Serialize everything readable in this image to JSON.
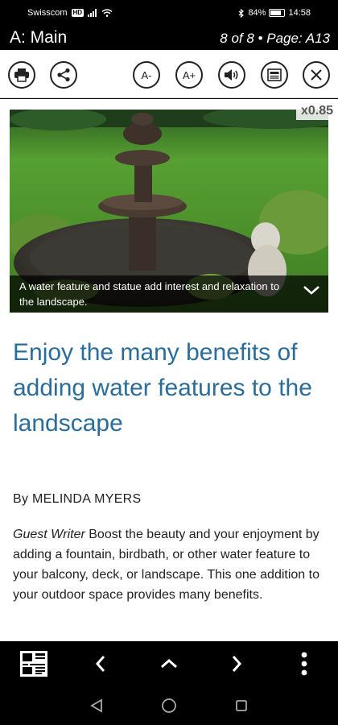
{
  "status_bar": {
    "carrier": "Swisscom",
    "network_badge": "HD",
    "battery_text": "84%",
    "battery_level": 0.84,
    "time": "14:58"
  },
  "title_bar": {
    "section": "A: Main",
    "page_info": "8 of 8 • Page: A13"
  },
  "toolbar": {
    "font_decrease_label": "A-",
    "font_increase_label": "A+",
    "icons": [
      "print-icon",
      "share-icon",
      "font-decrease-icon",
      "font-increase-icon",
      "speaker-icon",
      "article-view-icon",
      "close-icon"
    ]
  },
  "article": {
    "zoom": "x0.85",
    "image_caption": "A water feature and statue add interest and relaxation to the landscape.",
    "headline": "Enjoy the many benefits of adding water features to the landscape",
    "byline": "By MELINDA MYERS",
    "author_role": "Guest Writer",
    "body": " Boost the beauty and your enjoyment by adding a fountain, birdbath, or other water feature to your balcony, deck, or landscape. This one addition to your outdoor space provides many benefits."
  },
  "colors": {
    "headline": "#2a6d9a",
    "bar_background": "#000000",
    "page_background": "#ffffff"
  }
}
